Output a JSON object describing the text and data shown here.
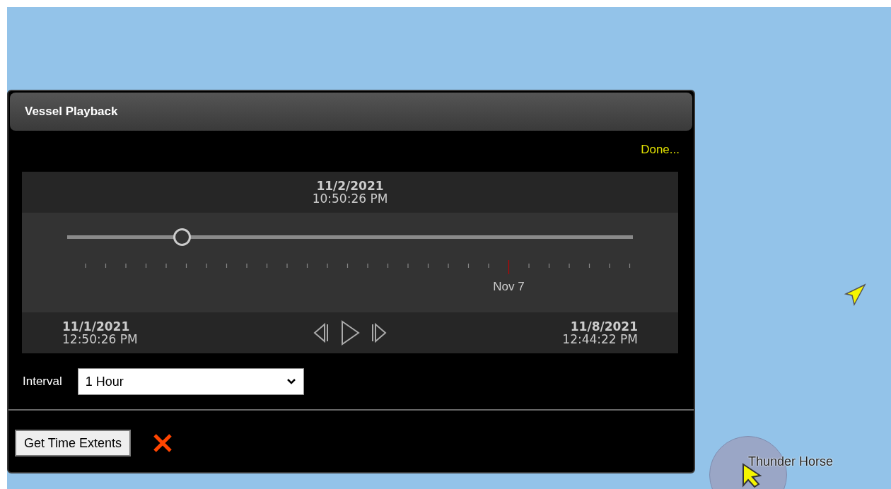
{
  "panel": {
    "title": "Vessel Playback",
    "done_link": "Done...",
    "current": {
      "date": "11/2/2021",
      "time": "10:50:26 PM"
    },
    "slider": {
      "level": 0.203
    },
    "timeline": {
      "marker_label": "Nov 7"
    },
    "start": {
      "date": "11/1/2021",
      "time": "12:50:26 PM"
    },
    "end": {
      "date": "11/8/2021",
      "time": "12:44:22 PM"
    },
    "interval": {
      "label": "Interval",
      "value": "1 Hour"
    },
    "get_extents_button": "Get Time Extents"
  },
  "map": {
    "vessel_label": "Thunder Horse"
  }
}
